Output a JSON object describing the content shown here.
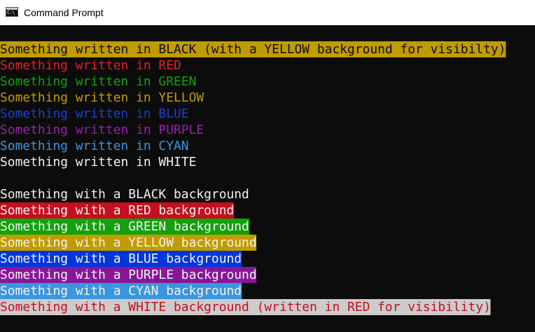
{
  "window": {
    "title": "Command Prompt",
    "icon": "cmd-icon",
    "icon_glyph": "C:\\"
  },
  "colors": {
    "console_bg": "#0c0c0c",
    "default_fg": "#cccccc",
    "black": "#0c0c0c",
    "red": "#e74856",
    "green": "#16c60c",
    "yellow": "#c19c00",
    "blue": "#3b78ff",
    "purple": "#b148c6",
    "cyan": "#61d6d6",
    "white": "#f2f2f2"
  },
  "console": {
    "lines": [
      {
        "text": "Something written in BLACK (with a YELLOW background for visibilty)",
        "fg": "#0c0c0c",
        "bg": "#c19c00"
      },
      {
        "text": "Something written in RED",
        "fg": "#e0202e",
        "bg": ""
      },
      {
        "text": "Something written in GREEN",
        "fg": "#13a10e",
        "bg": ""
      },
      {
        "text": "Something written in YELLOW",
        "fg": "#c19c00",
        "bg": ""
      },
      {
        "text": "Something written in BLUE",
        "fg": "#1a3fd6",
        "bg": ""
      },
      {
        "text": "Something written in PURPLE",
        "fg": "#9b1fae",
        "bg": ""
      },
      {
        "text": "Something written in CYAN",
        "fg": "#3a96dd",
        "bg": ""
      },
      {
        "text": "Something written in WHITE",
        "fg": "#f2f2f2",
        "bg": ""
      },
      {
        "text": "",
        "fg": "",
        "bg": ""
      },
      {
        "text": "Something with a BLACK background",
        "fg": "#f2f2f2",
        "bg": "#0c0c0c"
      },
      {
        "text": "Something with a RED background",
        "fg": "#f2f2f2",
        "bg": "#c50f1f"
      },
      {
        "text": "Something with a GREEN background",
        "fg": "#f2f2f2",
        "bg": "#13a10e"
      },
      {
        "text": "Something with a YELLOW background",
        "fg": "#f2f2f2",
        "bg": "#c19c00"
      },
      {
        "text": "Something with a BLUE background",
        "fg": "#f2f2f2",
        "bg": "#0037da"
      },
      {
        "text": "Something with a PURPLE background",
        "fg": "#f2f2f2",
        "bg": "#881798"
      },
      {
        "text": "Something with a CYAN background",
        "fg": "#f2f2f2",
        "bg": "#3a96dd"
      },
      {
        "text": "Something with a WHITE background (written in RED for visibility)",
        "fg": "#c50f1f",
        "bg": "#cccccc"
      }
    ]
  }
}
